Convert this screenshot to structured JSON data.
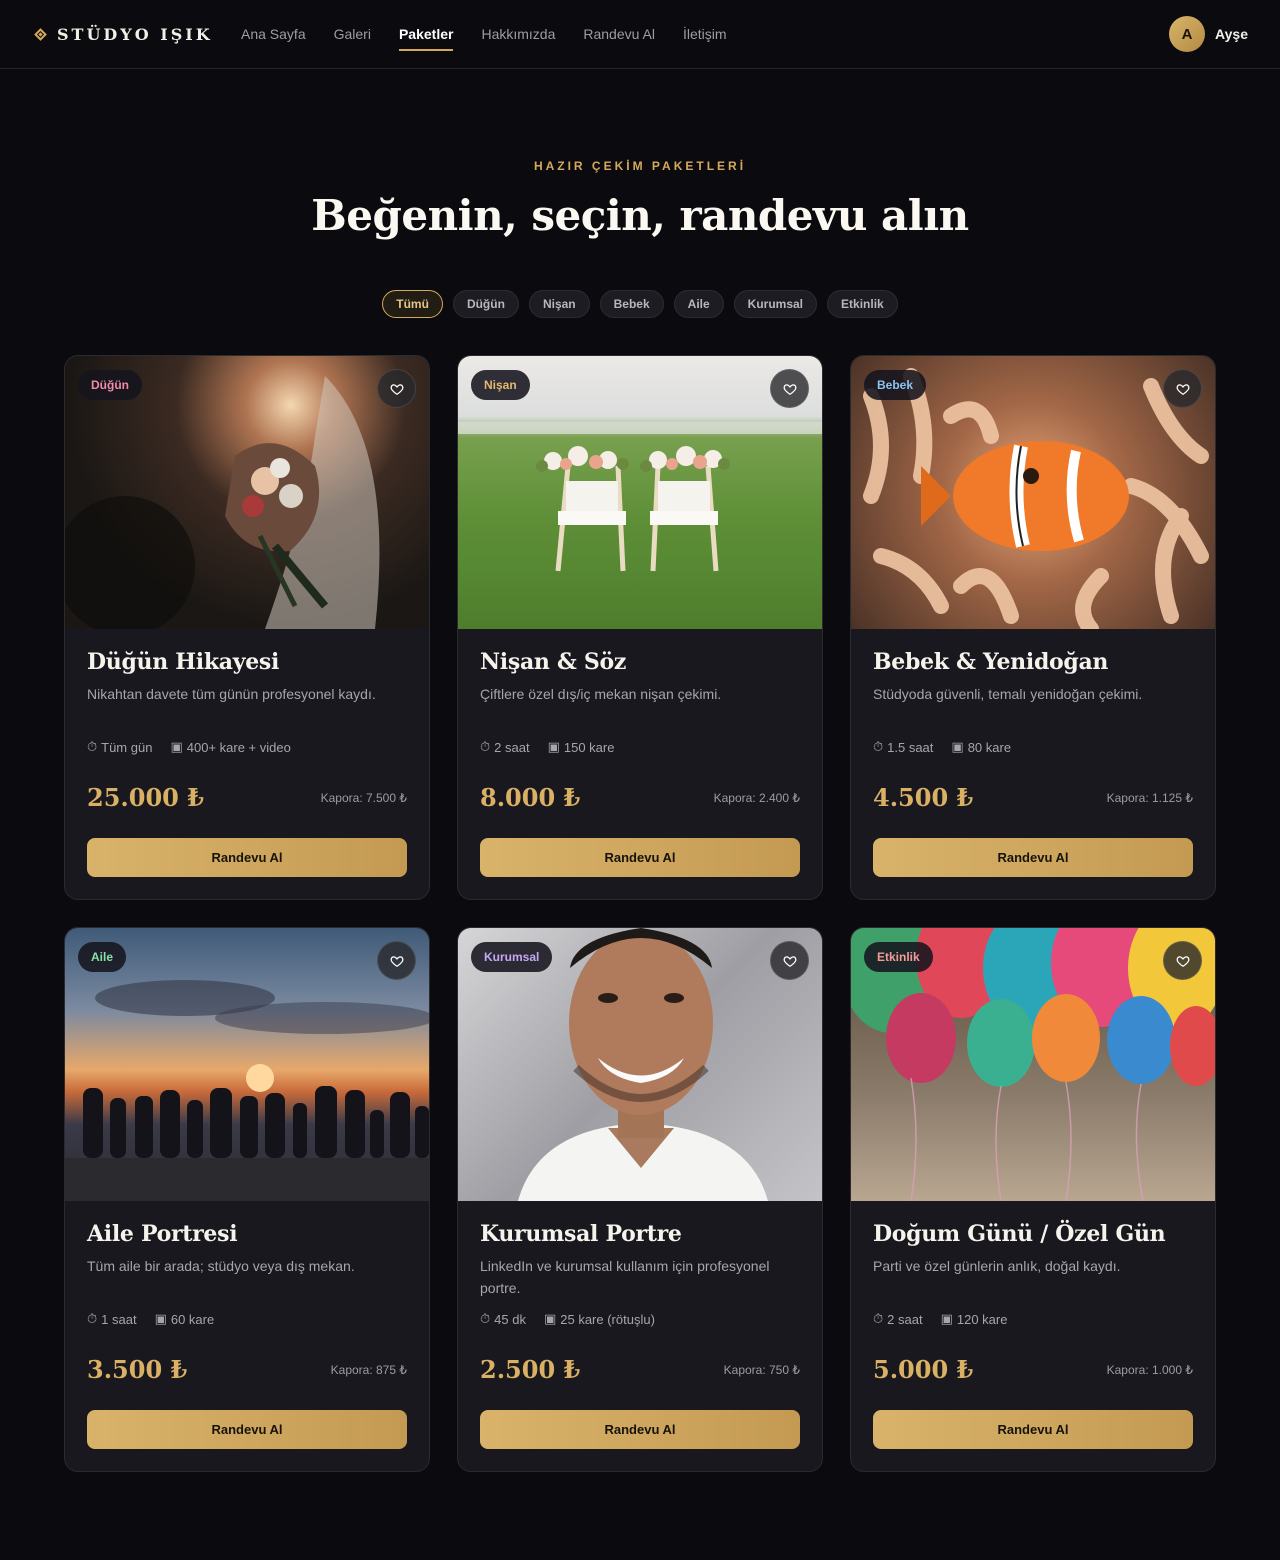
{
  "nav": {
    "brand": "STÜDYO IŞIK",
    "links": [
      {
        "label": "Ana Sayfa",
        "active": false
      },
      {
        "label": "Galeri",
        "active": false
      },
      {
        "label": "Paketler",
        "active": true
      },
      {
        "label": "Hakkımızda",
        "active": false
      },
      {
        "label": "Randevu Al",
        "active": false
      },
      {
        "label": "İletişim",
        "active": false
      }
    ],
    "user": {
      "initial": "A",
      "name": "Ayşe"
    }
  },
  "hero": {
    "eyebrow": "HAZIR ÇEKİM PAKETLERİ",
    "title": "Beğenin, seçin, randevu alın"
  },
  "filters": [
    {
      "label": "Tümü",
      "active": true
    },
    {
      "label": "Düğün",
      "active": false
    },
    {
      "label": "Nişan",
      "active": false
    },
    {
      "label": "Bebek",
      "active": false
    },
    {
      "label": "Aile",
      "active": false
    },
    {
      "label": "Kurumsal",
      "active": false
    },
    {
      "label": "Etkinlik",
      "active": false
    }
  ],
  "colors": {
    "accent": "#d4a95c",
    "background": "#0b0b0f",
    "card": "#18181e"
  },
  "packages": [
    {
      "tag": "Düğün",
      "tag_color": "#f08aa8",
      "title": "Düğün Hikayesi",
      "desc": "Nikahtan davete tüm günün profesyonel kaydı.",
      "duration": "Tüm gün",
      "frames": "400+ kare + video",
      "price": "25.000 ₺",
      "deposit": "Kapora: 7.500 ₺",
      "cta": "Randevu Al",
      "image": "bride-bouquet-photo"
    },
    {
      "tag": "Nişan",
      "tag_color": "#e6b870",
      "title": "Nişan & Söz",
      "desc": "Çiftlere özel dış/iç mekan nişan çekimi.",
      "duration": "2 saat",
      "frames": "150 kare",
      "price": "8.000 ₺",
      "deposit": "Kapora: 2.400 ₺",
      "cta": "Randevu Al",
      "image": "decorated-chairs-photo"
    },
    {
      "tag": "Bebek",
      "tag_color": "#8cc4f2",
      "title": "Bebek & Yenidoğan",
      "desc": "Stüdyoda güvenli, temalı yenidoğan çekimi.",
      "duration": "1.5 saat",
      "frames": "80 kare",
      "price": "4.500 ₺",
      "deposit": "Kapora: 1.125 ₺",
      "cta": "Randevu Al",
      "image": "clownfish-photo"
    },
    {
      "tag": "Aile",
      "tag_color": "#86e0a4",
      "title": "Aile Portresi",
      "desc": "Tüm aile bir arada; stüdyo veya dış mekan.",
      "duration": "1 saat",
      "frames": "60 kare",
      "price": "3.500 ₺",
      "deposit": "Kapora: 875 ₺",
      "cta": "Randevu Al",
      "image": "family-sunset-photo"
    },
    {
      "tag": "Kurumsal",
      "tag_color": "#c6a6f5",
      "title": "Kurumsal Portre",
      "desc": "LinkedIn ve kurumsal kullanım için profesyonel portre.",
      "duration": "45 dk",
      "frames": "25 kare (rötuşlu)",
      "price": "2.500 ₺",
      "deposit": "Kapora: 750 ₺",
      "cta": "Randevu Al",
      "image": "man-portrait-photo"
    },
    {
      "tag": "Etkinlik",
      "tag_color": "#f59a9a",
      "title": "Doğum Günü / Özel Gün",
      "desc": "Parti ve özel günlerin anlık, doğal kaydı.",
      "duration": "2 saat",
      "frames": "120 kare",
      "price": "5.000 ₺",
      "deposit": "Kapora: 1.000 ₺",
      "cta": "Randevu Al",
      "image": "balloons-photo"
    }
  ]
}
